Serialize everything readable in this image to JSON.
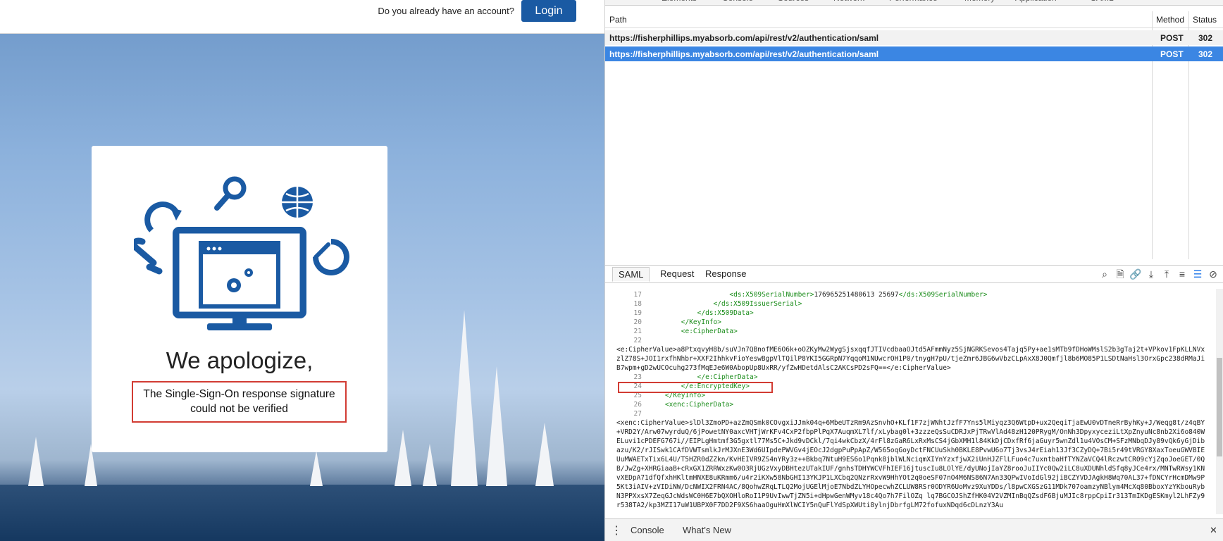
{
  "page": {
    "account_question": "Do you already have an account?",
    "login_label": "Login",
    "apology": "We apologize,",
    "error_line1": "The Single-Sign-On response signature",
    "error_line2": "could not be verified",
    "accent": "#1a5aa3",
    "error_border": "#d23c33"
  },
  "devtools": {
    "top_tabs": [
      "Elements",
      "Console",
      "Sources",
      "Network",
      "Performance",
      "Memory",
      "Application",
      "SAML"
    ],
    "columns": {
      "path": "Path",
      "method": "Method",
      "status": "Status"
    },
    "requests": [
      {
        "path": "https://fisherphillips.myabsorb.com/api/rest/v2/authentication/saml",
        "method": "POST",
        "status": "302"
      },
      {
        "path": "https://fisherphillips.myabsorb.com/api/rest/v2/authentication/saml",
        "method": "POST",
        "status": "302"
      }
    ],
    "saml_tabs": [
      "SAML",
      "Request",
      "Response"
    ],
    "tool_icons": [
      "search-icon",
      "document-icon",
      "link-icon",
      "download-icon",
      "upload-icon",
      "wrap-icon",
      "list-icon",
      "block-icon"
    ],
    "drawer_tabs": [
      "Console",
      "What's New"
    ],
    "code_lines": [
      {
        "n": "17",
        "indent": "                    ",
        "open": "<ds:X509SerialNumber>",
        "text": "176965251480613 25697",
        "close": "</ds:X509SerialNumber>"
      },
      {
        "n": "18",
        "indent": "                ",
        "open": "</ds:X509IssuerSerial>",
        "text": "",
        "close": ""
      },
      {
        "n": "19",
        "indent": "            ",
        "open": "</ds:X509Data>",
        "text": "",
        "close": ""
      },
      {
        "n": "20",
        "indent": "        ",
        "open": "</KeyInfo>",
        "text": "",
        "close": ""
      },
      {
        "n": "21",
        "indent": "        ",
        "open": "<e:CipherData>",
        "text": "",
        "close": ""
      },
      {
        "n": "22",
        "indent": "",
        "open": "",
        "text": "",
        "close": ""
      }
    ],
    "cipher_value_1": "<e:CipherValue>a8PtxqvyH8b/suVJn7QBnofME6O6k+oOZKyMw2WygSjsxqqfJTIVcdbaaOJtd5AFmmNyz5SjNGRKSevos4Tajq5Py+ae1sMTb9fDHoWMslS2b3gTaj2t+VPkov1FpKLLNVxzlZ78S+JOI1rxfhNhbr+XXF2IhhkvFioYeswBgpVlTQilP8YKI5GGRpN7YqqoM1NUwcrOH1P0/tnygH7pU/tjeZmr6JBG6wVbzCLpAxX8J0Qmfjl8b6MO85P1LSDtNaHsl3OrxGpc238dRMaJiB7wpm+gD2wUCOcuhg273fMqEJe6W0AbopUp8UxRR/yfZwHDetdAlsC2AKCsPD2sFQ==</e:CipherValue>",
    "code_lines_b": [
      {
        "n": "23",
        "indent": "            ",
        "open": "</e:CipherData>"
      },
      {
        "n": "24",
        "indent": "        ",
        "open": "</e:EncryptedKey>"
      },
      {
        "n": "25",
        "indent": "    ",
        "open": "</KeyInfo>"
      },
      {
        "n": "26",
        "indent": "    ",
        "open": "<xenc:CipherData>"
      },
      {
        "n": "27",
        "indent": "",
        "open": ""
      }
    ],
    "cipher_value_2": "<xenc:CipherValue>slDl3ZmoPD+azZmQSmk0COvgxiJJmk04q+6MbeUTzRm9AzSnvhO+KLf1F7zjWNhtJzfF7Yns5lMiyqz3Q6WtpD+ux2QeqiTjaEwU0vDTneRrByhKy+J/Weqg8t/z4qBY+VRD2Y/Arw07wyrduQ/6jPowetNY0axcVHTjWrKFv4CxP2fbpPlPqX7AuqmXL7lf/xLybag0l+3zzzeQsSuCDRJxPjTRwVlAd48zH120PRygM/OnNh3DpyxyceziLtXpZnyuNc8nb2Xi6o840WELuvi1cPDEFG767i//EIPLgHmtmf3G5gxtl77Ms5C+Jkd9vDCkl/7qi4wkCbzX/4rFl8zGaR6LxRxMsCS4jGbXMH1l84KkDjCDxfRf6jaGuyr5wnZdl1u4VOsCM+SFzMNbqDJy89vQk6yGjDibazu/K2/rJISwk1CAfDVWTsmlkJrMJXnE3Wd6UIpdePWVGv4jEOcJ2dgpPuPpApZ/W565oqGoyDctFNCUuSkh0BKLE8PvwU6o7Tj3vsJ4rEiah13Jf3CZyDQ+7Bi5r49tVRGY8XaxToeuGWVBIEUuMWAETxTix6L4U/T5HZR0dZZkn/KvHEIVR9ZS4nYRy3z++Bkbq7NtuH9ES6o1Pqnk8jblWLNciqmXIYnYzxfjwX2iUnHJZFlLFuo4c7uxntbaHfTYNZaVCQ4lRczwtCR09cYjZqoJoeGET/0QB/JwZg+XHRGiaaB+cRxGX1ZRRWxzKw0O3RjUGzVxyDBHtezUTakIUF/gnhsTDHYWCVFhIEF16jtuscIu8LOlYE/dyUNojIaYZ8rooJuIIYc0Qw2iLC8uXDUNhldSfq8yJCe4rx/MNTwRWsy1KNvXEDpA71dfQfxhHKltmHNXE8uKRmm6/u4r2iKXw58NbGHI13YKJP1LXCbq2QNzrRxvW9HhYOt2q0oeSF07nO4M6NS86N7An33QPwIVoIdGl92jiBCZYVDJAgkH8Wq70AL37+fDNCYrHcmDMw9P5Kt3iAIV+zVIDiNW/DcNWIX2FRN4AC/8QohwZRqLTLQ2MojUGElMjoE7NbdZLYHOpecwhZCLUW8RSr0ODYR6UoMvz9XuYDDs/l8pwCXGSzG11MDk707oamzyNBlym4McXq80BboxYzYKbouRybN3PPXxsX7ZeqGJcWdsWC0H6E7bQXOHloRoI1P9UvIwwTjZN5i+dHpwGenWMyv18c4Qo7h7FilOZq lq7BGCOJShZfHK04V2VZMInBqQZsdF6BjuMJIc8rppCpiIr313TmIKDgESKmyl2LhFZy9r538TA2/kp3MZI17uW1UBPX0F7DD2F9XS6haaOguHmXlWCIY5nQuFlYdSpXWUti8ylnjDbrfgLM72fofuxNDqd6cDLnzY3Au"
  }
}
